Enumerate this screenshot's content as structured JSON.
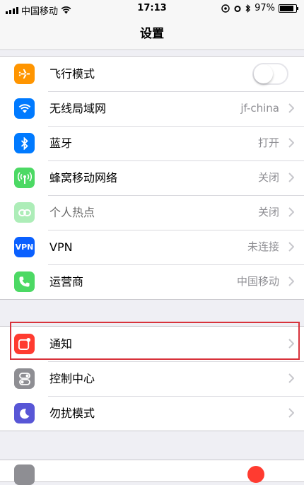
{
  "status_bar": {
    "carrier": "中国移动",
    "time": "17:13",
    "battery_percent": "97%",
    "battery_level": 0.97
  },
  "nav": {
    "title": "设置"
  },
  "group1": [
    {
      "label": "飞行模式",
      "icon": "airplane-icon",
      "color": "#ff9500",
      "toggle": false
    },
    {
      "label": "无线局域网",
      "value": "jf-china",
      "icon": "wifi-icon",
      "color": "#007aff"
    },
    {
      "label": "蓝牙",
      "value": "打开",
      "icon": "bluetooth-icon",
      "color": "#007aff"
    },
    {
      "label": "蜂窝移动网络",
      "value": "关闭",
      "icon": "cellular-icon",
      "color": "#4cd964"
    },
    {
      "label": "个人热点",
      "value": "关闭",
      "icon": "hotspot-icon",
      "color": "#4cd964",
      "disabled": true
    },
    {
      "label": "VPN",
      "value": "未连接",
      "icon": "vpn-icon",
      "icon_text": "VPN",
      "color": "#0a60ff"
    },
    {
      "label": "运营商",
      "value": "中国移动",
      "icon": "phone-icon",
      "color": "#4cd964"
    }
  ],
  "group2": [
    {
      "label": "通知",
      "icon": "notifications-icon",
      "color": "#ff3b30",
      "highlighted": true
    },
    {
      "label": "控制中心",
      "icon": "control-center-icon",
      "color": "#8e8e93"
    },
    {
      "label": "勿扰模式",
      "icon": "moon-icon",
      "color": "#5856d6"
    }
  ],
  "colors": {
    "highlight_border": "#d8323b",
    "chevron": "#c7c7cc",
    "value_text": "#8e8e93"
  }
}
